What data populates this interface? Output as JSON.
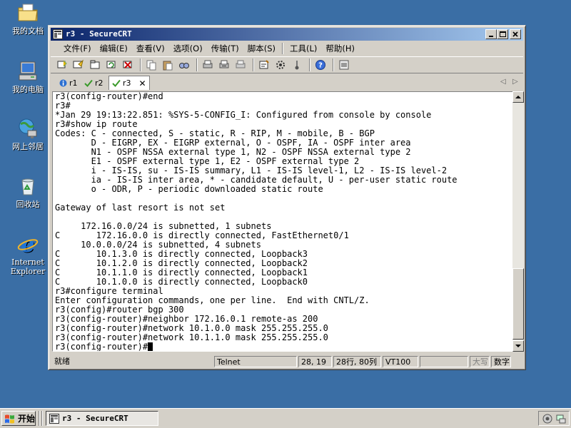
{
  "desktop": {
    "icons": [
      {
        "label": "我的文档"
      },
      {
        "label": "我的电脑"
      },
      {
        "label": "网上邻居"
      },
      {
        "label": "回收站"
      },
      {
        "label_line1": "Internet",
        "label_line2": "Explorer"
      }
    ]
  },
  "window": {
    "title": "r3 - SecureCRT",
    "menu": [
      "文件(F)",
      "编辑(E)",
      "查看(V)",
      "选项(O)",
      "传输(T)",
      "脚本(S)",
      "工具(L)",
      "帮助(H)"
    ],
    "toolbar_icons": [
      "connect-icon",
      "quick-connect-icon",
      "connect-tab-icon",
      "reconnect-icon",
      "disconnect-icon",
      "copy-icon",
      "paste-icon",
      "find-icon",
      "print-icon",
      "print-selection-icon",
      "print-screen-icon",
      "session-options-icon",
      "global-options-icon",
      "keymap-icon",
      "help-icon",
      "log-icon"
    ],
    "tabs": [
      {
        "label": "r1",
        "status": "info"
      },
      {
        "label": "r2",
        "status": "connected"
      },
      {
        "label": "r3",
        "status": "connected",
        "active": true
      }
    ]
  },
  "terminal": {
    "lines": [
      "r3(config-router)#end",
      "r3#",
      "*Jan 29 19:13:22.851: %SYS-5-CONFIG_I: Configured from console by console",
      "r3#show ip route",
      "Codes: C - connected, S - static, R - RIP, M - mobile, B - BGP",
      "       D - EIGRP, EX - EIGRP external, O - OSPF, IA - OSPF inter area",
      "       N1 - OSPF NSSA external type 1, N2 - OSPF NSSA external type 2",
      "       E1 - OSPF external type 1, E2 - OSPF external type 2",
      "       i - IS-IS, su - IS-IS summary, L1 - IS-IS level-1, L2 - IS-IS level-2",
      "       ia - IS-IS inter area, * - candidate default, U - per-user static route",
      "       o - ODR, P - periodic downloaded static route",
      "",
      "Gateway of last resort is not set",
      "",
      "     172.16.0.0/24 is subnetted, 1 subnets",
      "C       172.16.0.0 is directly connected, FastEthernet0/1",
      "     10.0.0.0/24 is subnetted, 4 subnets",
      "C       10.1.3.0 is directly connected, Loopback3",
      "C       10.1.2.0 is directly connected, Loopback2",
      "C       10.1.1.0 is directly connected, Loopback1",
      "C       10.1.0.0 is directly connected, Loopback0",
      "r3#configure terminal",
      "Enter configuration commands, one per line.  End with CNTL/Z.",
      "r3(config)#router bgp 300",
      "r3(config-router)#neighbor 172.16.0.1 remote-as 200",
      "r3(config-router)#network 10.1.0.0 mask 255.255.255.0",
      "r3(config-router)#network 10.1.1.0 mask 255.255.255.0",
      "r3(config-router)#"
    ]
  },
  "statusbar": {
    "ready": "就绪",
    "protocol": "Telnet",
    "cursor_pos": "28, 19",
    "size": "28行, 80列",
    "emulation": "VT100",
    "caps": "大写",
    "num": "数字"
  },
  "taskbar": {
    "start_label": "开始",
    "task_label": "r3 - SecureCRT"
  },
  "colors": {
    "desktop": "#3a6ea5",
    "title_start": "#0a246a",
    "title_end": "#a6caf0",
    "chrome": "#d4d0c8"
  }
}
